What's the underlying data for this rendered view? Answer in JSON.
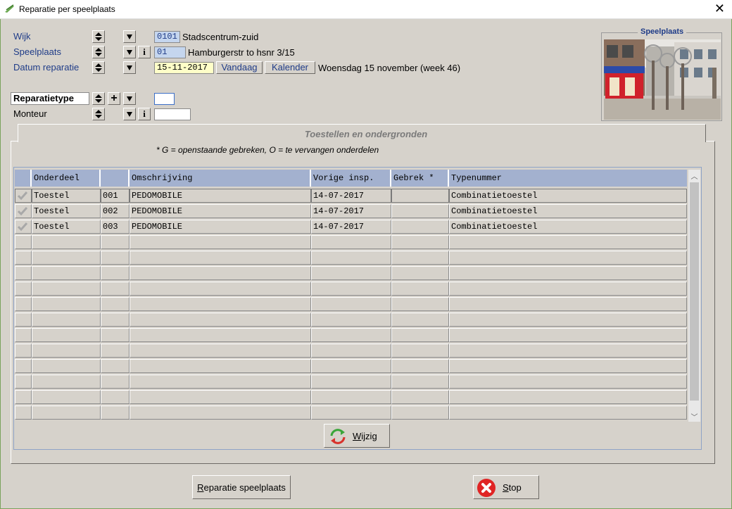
{
  "window": {
    "title": "Reparatie per speelplaats"
  },
  "fields": {
    "wijk": {
      "label": "Wijk",
      "code": "0101",
      "name": "Stadscentrum-zuid"
    },
    "speelplaats": {
      "label": "Speelplaats",
      "code": "01",
      "name": "Hamburgerstr to hsnr 3/15"
    },
    "datum": {
      "label": "Datum reparatie",
      "value": "15-11-2017",
      "today_label": "Vandaag",
      "calendar_label": "Kalender",
      "description": "Woensdag 15 november (week 46)"
    },
    "reparatietype": {
      "label": "Reparatietype",
      "value": ""
    },
    "monteur": {
      "label": "Monteur",
      "value": ""
    }
  },
  "photo_box": {
    "title": "Speelplaats"
  },
  "tab": {
    "title": "Toestellen en ondergronden",
    "note": "* G = openstaande gebreken, O = te vervangen onderdelen"
  },
  "grid": {
    "columns": [
      "",
      "Onderdeel",
      "",
      "Omschrijving",
      "Vorige insp.",
      "Gebrek *",
      "Typenummer"
    ],
    "rows": [
      {
        "checked": true,
        "onderdeel": "Toestel",
        "nr": "001",
        "omschrijving": "PEDOMOBILE",
        "vorige": "14-07-2017",
        "gebrek": "",
        "typenummer": "Combinatietoestel"
      },
      {
        "checked": true,
        "onderdeel": "Toestel",
        "nr": "002",
        "omschrijving": "PEDOMOBILE",
        "vorige": "14-07-2017",
        "gebrek": "",
        "typenummer": "Combinatietoestel"
      },
      {
        "checked": true,
        "onderdeel": "Toestel",
        "nr": "003",
        "omschrijving": "PEDOMOBILE",
        "vorige": "14-07-2017",
        "gebrek": "",
        "typenummer": "Combinatietoestel"
      }
    ],
    "empty_rows": 12
  },
  "buttons": {
    "wijzig": "Wijzig",
    "reparatie": "Reparatie speelplaats",
    "stop": "Stop"
  },
  "colors": {
    "accent_text": "#1f3c88",
    "header_bg": "#a3b1cf",
    "window_bg": "#d6d2cb",
    "code_bg": "#c5d6ee",
    "date_bg": "#ffffc8"
  }
}
